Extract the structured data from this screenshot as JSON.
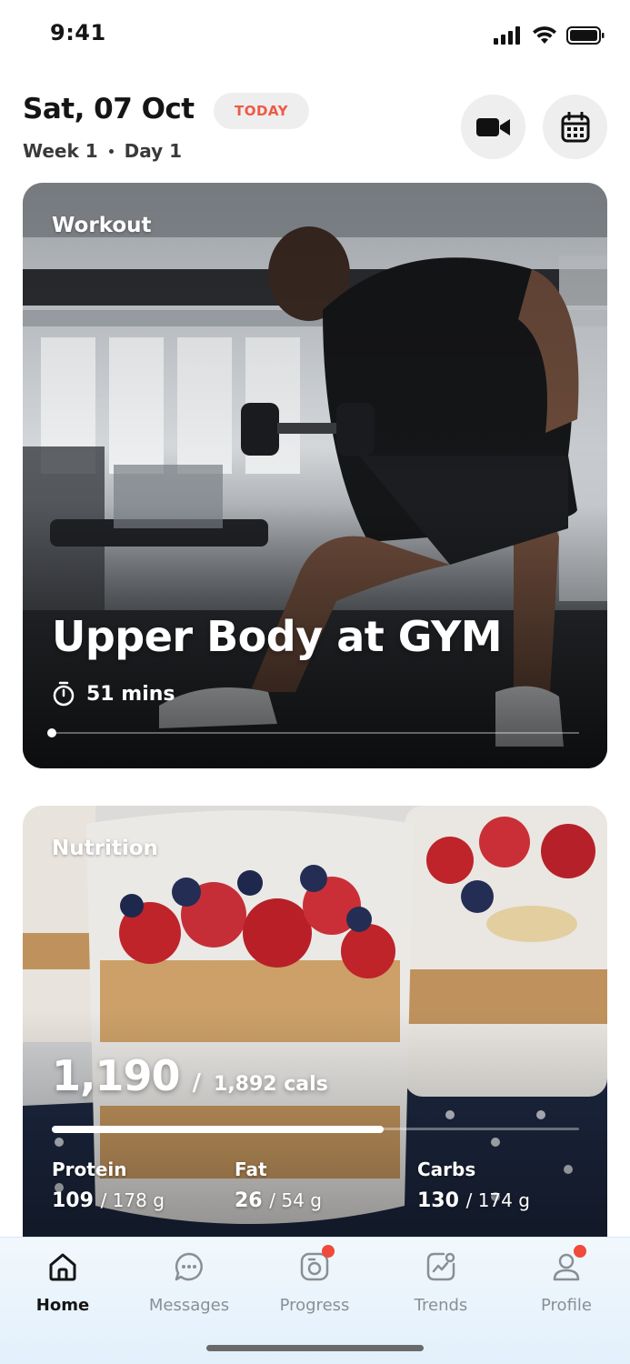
{
  "status_bar": {
    "time": "9:41"
  },
  "header": {
    "date": "Sat, 07 Oct",
    "today_badge": "TODAY",
    "week": "Week 1",
    "day": "Day 1",
    "video_button_icon": "video-camera-icon",
    "calendar_button_icon": "calendar-icon"
  },
  "workout": {
    "label": "Workout",
    "title": "Upper Body at GYM",
    "duration": "51 mins",
    "progress": 0.0
  },
  "nutrition": {
    "label": "Nutrition",
    "calories_consumed": "1,190",
    "calories_separator": "/",
    "calories_goal": "1,892 cals",
    "calories_progress": 0.629,
    "macros": [
      {
        "name": "Protein",
        "value": "109",
        "goal": "/ 178 g"
      },
      {
        "name": "Fat",
        "value": "26",
        "goal": "/ 54 g"
      },
      {
        "name": "Carbs",
        "value": "130",
        "goal": "/ 174 g"
      }
    ]
  },
  "tabs": [
    {
      "label": "Home",
      "icon": "home-icon",
      "active": true,
      "badge": false
    },
    {
      "label": "Messages",
      "icon": "message-icon",
      "active": false,
      "badge": false
    },
    {
      "label": "Progress",
      "icon": "progress-icon",
      "active": false,
      "badge": true
    },
    {
      "label": "Trends",
      "icon": "trends-icon",
      "active": false,
      "badge": false
    },
    {
      "label": "Profile",
      "icon": "profile-icon",
      "active": false,
      "badge": true
    }
  ],
  "colors": {
    "accent_red": "#ee5a46",
    "badge_bg": "#eeeeee",
    "notif_dot": "#f04a3a",
    "tab_bar_bg": "#e8f3fb"
  }
}
